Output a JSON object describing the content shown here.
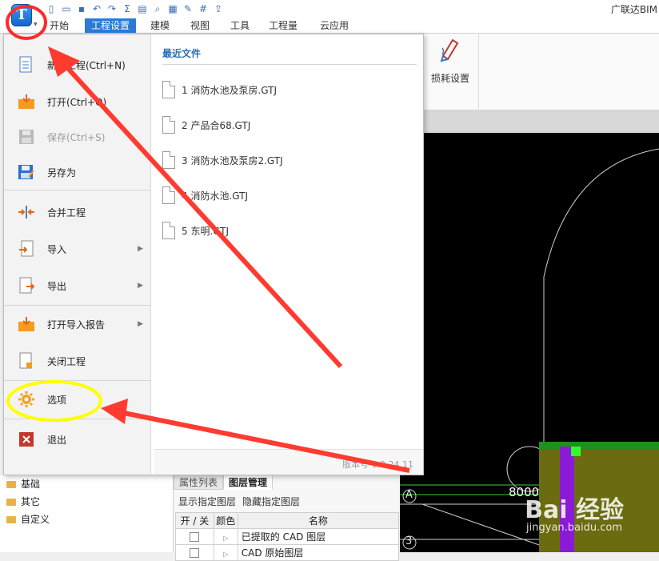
{
  "app": {
    "title": "广联达BIM",
    "button_letter": "T"
  },
  "quick_access": [
    "new-file-icon",
    "open-folder-icon",
    "save-icon",
    "undo-icon",
    "redo-icon",
    "sum-icon",
    "report-icon",
    "query-icon",
    "calc-icon",
    "pen-icon",
    "grid-icon",
    "export-icon"
  ],
  "ribbon_tabs": [
    {
      "label": "开始",
      "active": false
    },
    {
      "label": "工程设置",
      "active": true
    },
    {
      "label": "建模",
      "active": false
    },
    {
      "label": "视图",
      "active": false
    },
    {
      "label": "工具",
      "active": false
    },
    {
      "label": "工程量",
      "active": false
    },
    {
      "label": "云应用",
      "active": false
    }
  ],
  "ribbon": {
    "loss_setting": "损耗设置"
  },
  "app_menu": {
    "items": [
      {
        "label": "新建工程(Ctrl+N)",
        "icon": "new-project-icon",
        "enabled": true,
        "submenu": false
      },
      {
        "label": "打开(Ctrl+O)",
        "icon": "open-icon",
        "enabled": true,
        "submenu": false
      },
      {
        "label": "保存(Ctrl+S)",
        "icon": "save-icon",
        "enabled": false,
        "submenu": false
      },
      {
        "label": "另存为",
        "icon": "save-as-icon",
        "enabled": true,
        "submenu": false
      },
      {
        "label": "合并工程",
        "icon": "merge-icon",
        "enabled": true,
        "submenu": false
      },
      {
        "label": "导入",
        "icon": "import-icon",
        "enabled": true,
        "submenu": true
      },
      {
        "label": "导出",
        "icon": "export-icon",
        "enabled": true,
        "submenu": true
      },
      {
        "label": "打开导入报告",
        "icon": "report-icon",
        "enabled": true,
        "submenu": true
      },
      {
        "label": "关闭工程",
        "icon": "close-project-icon",
        "enabled": true,
        "submenu": false
      },
      {
        "label": "选项",
        "icon": "options-gear-icon",
        "enabled": true,
        "submenu": false
      },
      {
        "label": "退出",
        "icon": "exit-icon",
        "enabled": true,
        "submenu": false
      }
    ],
    "recent_title": "最近文件",
    "recent_files": [
      "1 消防水池及泵房.GTJ",
      "2 产品合68.GTJ",
      "3 消防水池及泵房2.GTJ",
      "4 消防水池.GTJ",
      "5 东明.GTJ"
    ],
    "version": "版本号 1.0.24.11"
  },
  "tree": {
    "items": [
      "基础",
      "其它",
      "自定义"
    ]
  },
  "layer_panel": {
    "tabs": [
      {
        "label": "属性列表",
        "active": false
      },
      {
        "label": "图层管理",
        "active": true
      }
    ],
    "actions": [
      "显示指定图层",
      "隐藏指定图层"
    ],
    "columns": [
      "开 / 关",
      "颜色",
      "名称"
    ],
    "rows": [
      {
        "name": "已提取的 CAD 图层"
      },
      {
        "name": "CAD 原始图层"
      }
    ]
  },
  "viewport": {
    "axis_labels": [
      "A",
      "3"
    ],
    "dimension": "8000"
  },
  "watermark": {
    "brand": "Bai 经验",
    "url": "jingyan.baidu.com"
  },
  "colors": {
    "accent": "#2b7bd6",
    "annotation": "#ff3b30",
    "highlight": "#ffff00"
  }
}
